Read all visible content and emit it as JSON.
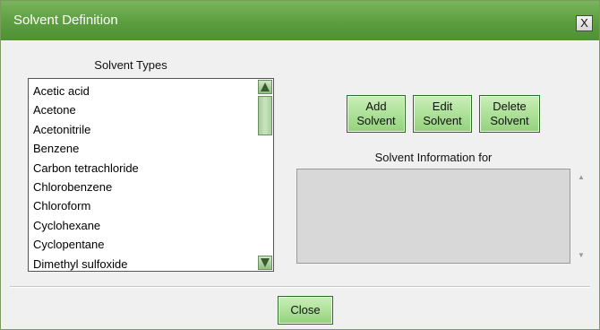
{
  "window": {
    "title": "Solvent Definition",
    "close_label": "X"
  },
  "solvent_types": {
    "label": "Solvent Types",
    "items": [
      "Acetic acid",
      "Acetone",
      "Acetonitrile",
      "Benzene",
      "Carbon tetrachloride",
      "Chlorobenzene",
      "Chloroform",
      "Cyclohexane",
      "Cyclopentane",
      "Dimethyl sulfoxide"
    ]
  },
  "buttons": {
    "add": [
      "Add",
      "Solvent"
    ],
    "edit": [
      "Edit",
      "Solvent"
    ],
    "delete": [
      "Delete",
      "Solvent"
    ],
    "close": "Close"
  },
  "info": {
    "label": "Solvent Information for",
    "value": ""
  },
  "colors": {
    "titlebar": "#5b9d3f",
    "button": "#a8dc92",
    "accent_border": "#2e6b26"
  }
}
